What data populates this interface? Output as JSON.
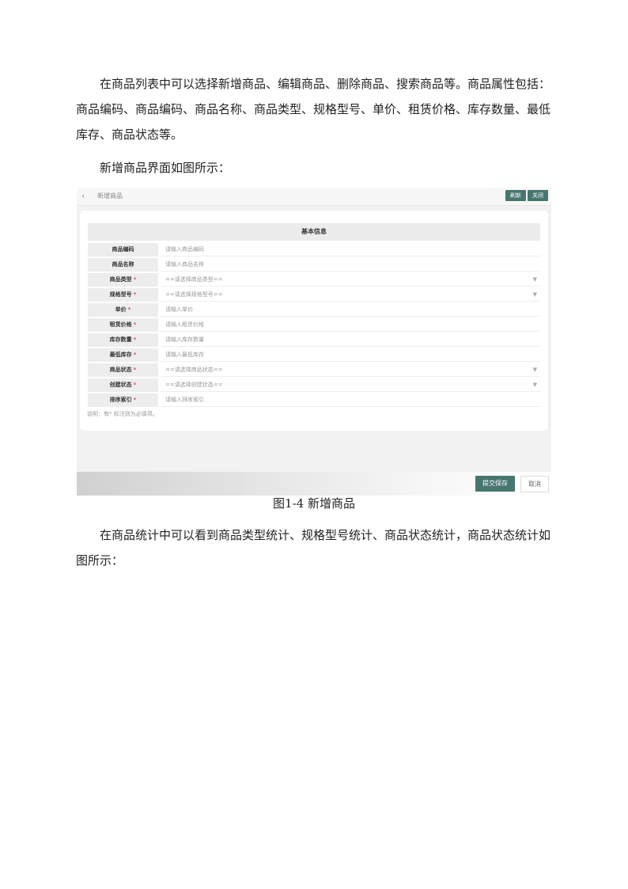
{
  "paragraphs": {
    "p1": "在商品列表中可以选择新增商品、编辑商品、删除商品、搜索商品等。商品属性包括：商品编码、商品编码、商品名称、商品类型、规格型号、单价、租赁价格、库存数量、最低库存、商品状态等。",
    "p2": "新增商品界面如图所示：",
    "p3": "在商品统计中可以看到商品类型统计、规格型号统计、商品状态统计，商品状态统计如图所示："
  },
  "figure": {
    "caption": "图1-4 新增商品",
    "breadcrumb": "新增商品",
    "refresh_label": "刷新",
    "close_label": "关闭",
    "section_title": "基本信息",
    "required_mark": "*",
    "fields": [
      {
        "label": "商品编码",
        "placeholder": "请输入商品编码"
      },
      {
        "label": "商品名称",
        "placeholder": "请输入商品名称"
      },
      {
        "label": "商品类型",
        "placeholder": "==请选择商品类型=="
      },
      {
        "label": "规格型号",
        "placeholder": "==请选择规格型号=="
      },
      {
        "label": "单价",
        "placeholder": "请输入单价"
      },
      {
        "label": "租赁价格",
        "placeholder": "请输入租赁价格"
      },
      {
        "label": "库存数量",
        "placeholder": "请输入库存数量"
      },
      {
        "label": "最低库存",
        "placeholder": "请输入最低库存"
      },
      {
        "label": "商品状态",
        "placeholder": "==请选择商品状态=="
      },
      {
        "label": "创建状态",
        "placeholder": "==请选择创建状态=="
      },
      {
        "label": "排序索引",
        "placeholder": "请输入排序索引"
      }
    ],
    "note": "说明：有* 标注则为必填项。",
    "submit_label": "提交保存",
    "cancel_label": "取消"
  }
}
